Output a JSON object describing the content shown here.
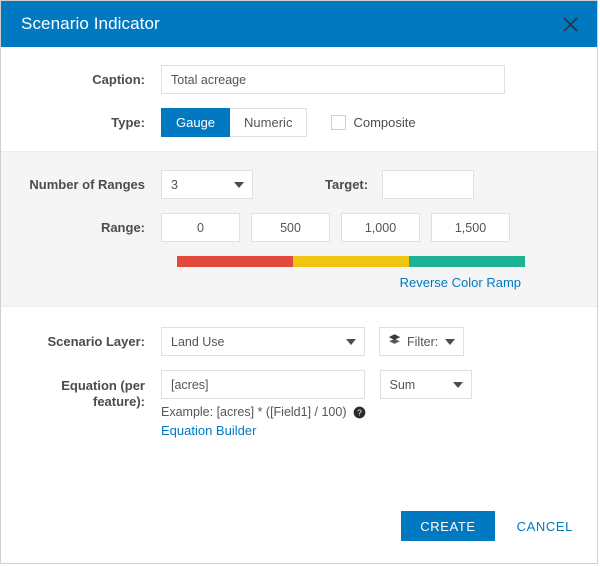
{
  "dialog": {
    "title": "Scenario Indicator",
    "close_icon": "close-icon"
  },
  "caption": {
    "label": "Caption:",
    "value": "Total acreage",
    "placeholder": ""
  },
  "type": {
    "label": "Type:",
    "options": [
      "Gauge",
      "Numeric"
    ],
    "selected": "Gauge",
    "composite_label": "Composite",
    "composite_checked": false
  },
  "ranges": {
    "number_label": "Number of Ranges",
    "number_value": "3",
    "target_label": "Target:",
    "target_value": "",
    "range_label": "Range:",
    "values": [
      "0",
      "500",
      "1,000",
      "1,500"
    ],
    "colors": [
      "#e2483c",
      "#efc511",
      "#1cb394"
    ],
    "reverse_link": "Reverse Color Ramp"
  },
  "scenario_layer": {
    "label": "Scenario Layer:",
    "value": "Land Use",
    "filter_label": "Filter:",
    "filter_icon": "layers-icon"
  },
  "equation": {
    "label_line1": "Equation (per",
    "label_line2": "feature):",
    "value": "[acres]",
    "aggregation": "Sum",
    "example": "Example: [acres] * ([Field1] / 100)",
    "help_icon": "help-icon",
    "builder_link": "Equation Builder"
  },
  "footer": {
    "create_label": "CREATE",
    "cancel_label": "CANCEL"
  },
  "theme": {
    "accent": "#0079c1",
    "panel_gray": "#f5f5f5"
  }
}
